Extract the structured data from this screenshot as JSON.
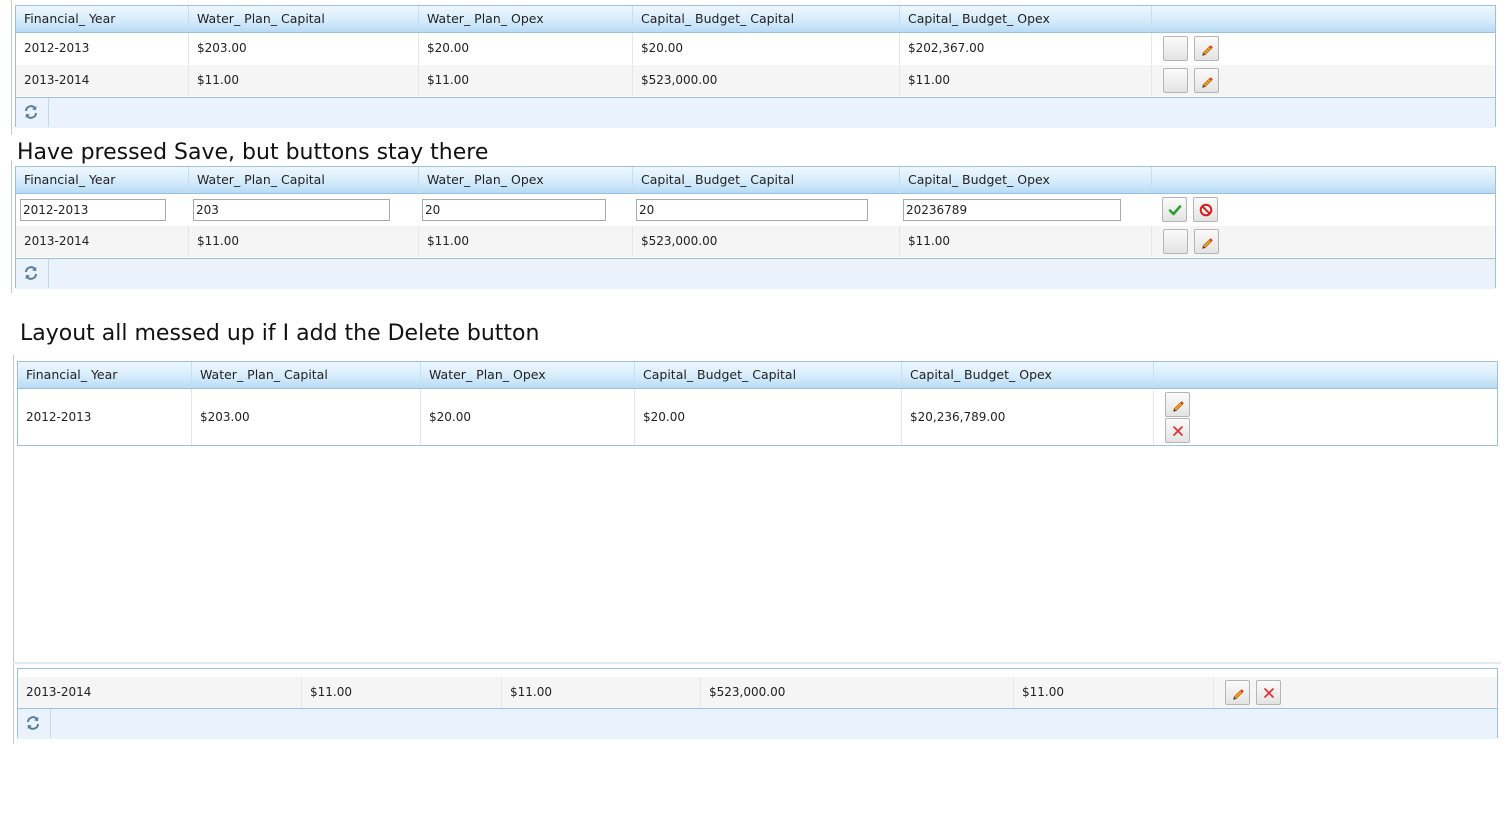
{
  "columns": [
    "Financial_ Year",
    "Water_ Plan_ Capital",
    "Water_ Plan_ Opex",
    "Capital_ Budget_ Capital",
    "Capital_ Budget_ Opex"
  ],
  "grid1": {
    "rows": [
      [
        "2012-2013",
        "$203.00",
        "$20.00",
        "$20.00",
        "$202,367.00"
      ],
      [
        "2013-2014",
        "$11.00",
        "$11.00",
        "$523,000.00",
        "$11.00"
      ]
    ]
  },
  "caption1": "Have pressed Save, but buttons stay there",
  "grid2": {
    "edit_values": [
      "2012-2013",
      "203",
      "20",
      "20",
      "20236789"
    ],
    "row2": [
      "2013-2014",
      "$11.00",
      "$11.00",
      "$523,000.00",
      "$11.00"
    ]
  },
  "caption2": "Layout all messed up if I add the Delete button",
  "grid3": {
    "row1": [
      "2012-2013",
      "$203.00",
      "$20.00",
      "$20.00",
      "$20,236,789.00"
    ],
    "row2": [
      "2013-2014",
      "$11.00",
      "$11.00",
      "$523,000.00",
      "$11.00"
    ]
  },
  "icons": {
    "edit": "pencil-icon",
    "save": "check-icon",
    "cancel": "no-entry-icon",
    "delete": "red-x-icon",
    "refresh": "refresh-icon"
  },
  "colors": {
    "header_gradient_top": "#eef7fe",
    "header_gradient_bottom": "#b7dbf5",
    "border": "#9fc0dc",
    "pager_bg": "#eaf3fc",
    "alt_row": "#f5f5f5",
    "save_green": "#2e9e2e",
    "cancel_red": "#d62020"
  }
}
